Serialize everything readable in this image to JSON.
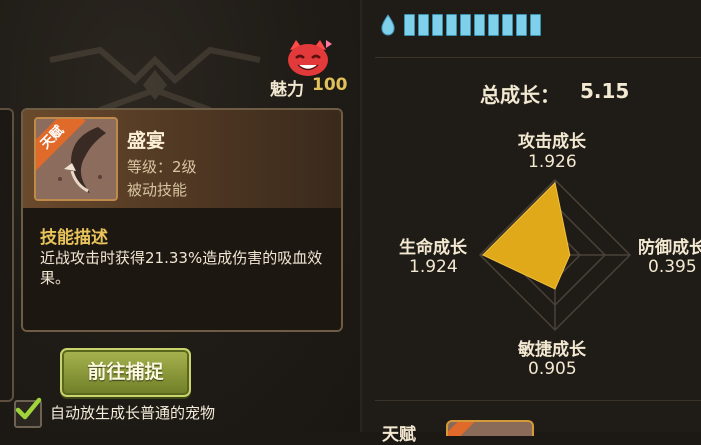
{
  "charm": {
    "label": "魅力",
    "value": "100",
    "icon": "devil-face-icon"
  },
  "skill": {
    "tag": "天赋",
    "name": "盛宴",
    "level": "等级：2级",
    "type": "被动技能",
    "desc_title": "技能描述",
    "desc_text": "近战攻击时获得21.33%造成伤害的吸血效果。",
    "icon": "beast-fang-icon"
  },
  "goto_button": "前往捕捉",
  "auto_release": {
    "label": "自动放生成长普通的宠物",
    "checked": true
  },
  "energy": {
    "icon": "water-drop-icon",
    "filled": 10,
    "total": 10
  },
  "growth": {
    "total_label": "总成长：",
    "total_value": "5.15",
    "attack": {
      "label": "攻击成长",
      "value": "1.926"
    },
    "defense": {
      "label": "防御成长",
      "value": "0.395"
    },
    "agility": {
      "label": "敏捷成长",
      "value": "0.905"
    },
    "hp": {
      "label": "生命成长",
      "value": "1.924"
    }
  },
  "talent_label": "天赋",
  "colors": {
    "radar_fill": "#e0a91a",
    "energy": "#7fd0ea",
    "accent_gold": "#e8c45a",
    "button_green": "#8a9a36"
  }
}
